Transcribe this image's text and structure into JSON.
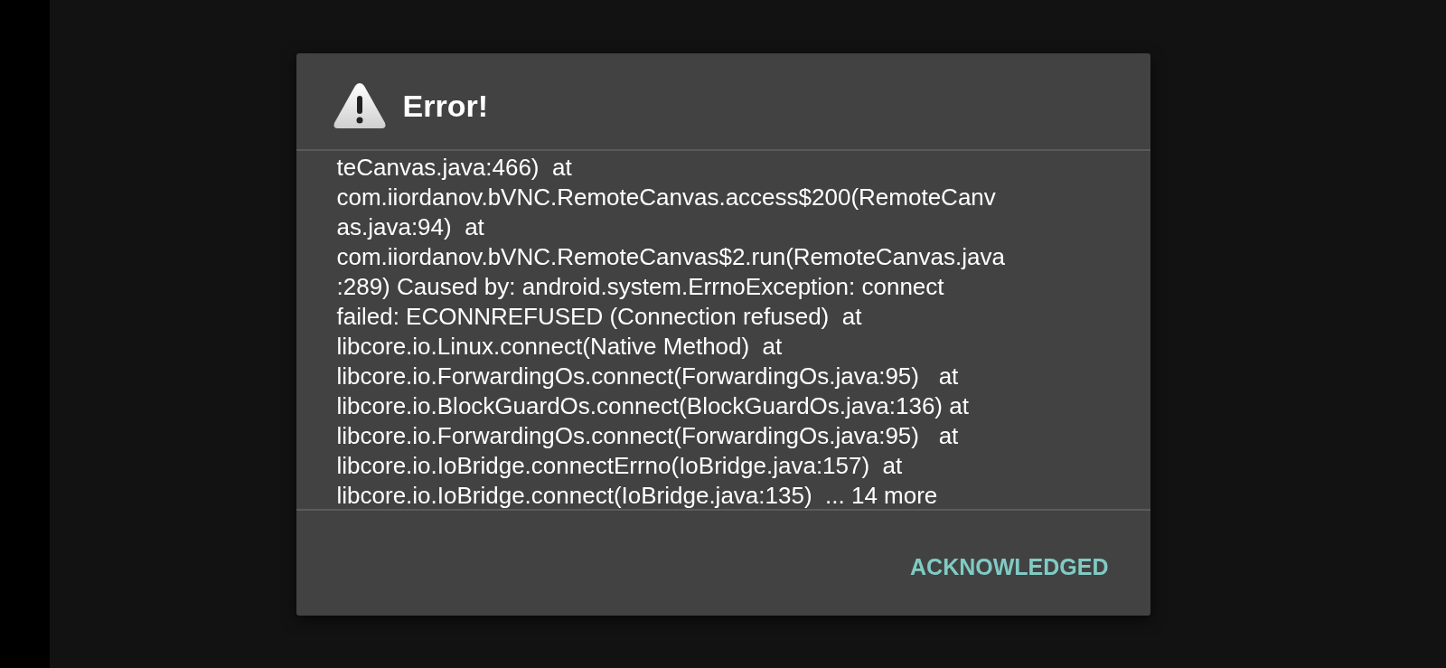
{
  "dialog": {
    "title": "Error!",
    "message_lines": [
      "teCanvas.java:466)  at",
      "com.iiordanov.bVNC.RemoteCanvas.access$200(RemoteCanv",
      "as.java:94)  at",
      "com.iiordanov.bVNC.RemoteCanvas$2.run(RemoteCanvas.java",
      ":289) Caused by: android.system.ErrnoException: connect",
      "failed: ECONNREFUSED (Connection refused)  at",
      "libcore.io.Linux.connect(Native Method)  at",
      "libcore.io.ForwardingOs.connect(ForwardingOs.java:95)   at",
      "libcore.io.BlockGuardOs.connect(BlockGuardOs.java:136) at",
      "libcore.io.ForwardingOs.connect(ForwardingOs.java:95)   at",
      "libcore.io.IoBridge.connectErrno(IoBridge.java:157)  at",
      "libcore.io.IoBridge.connect(IoBridge.java:135)  ... 14 more"
    ],
    "buttons": [
      "ACKNOWLEDGED"
    ]
  }
}
